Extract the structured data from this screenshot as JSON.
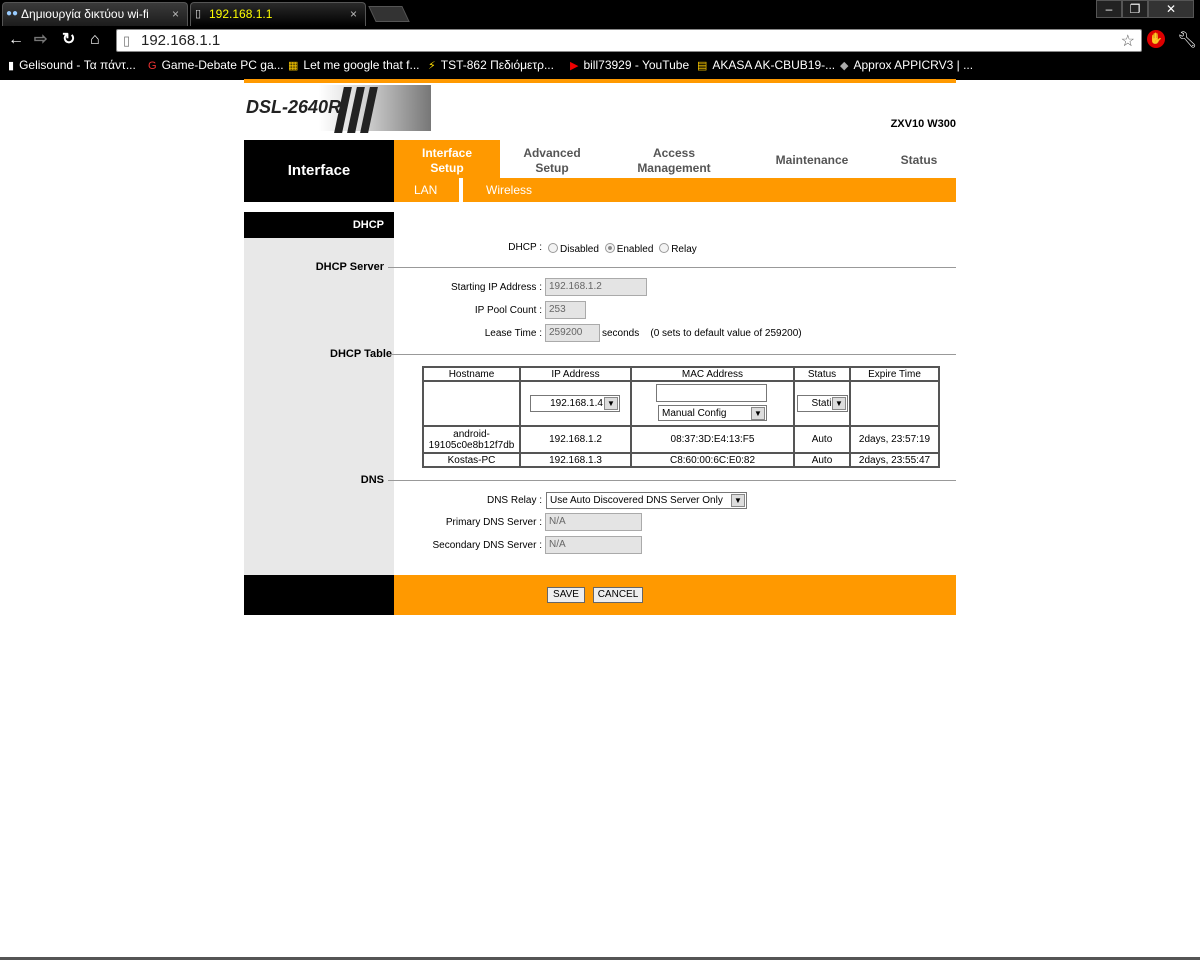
{
  "browser": {
    "tabs": [
      {
        "title": "Δημιουργία δικτύου wi-fi",
        "close": "×"
      },
      {
        "title": "192.168.1.1",
        "close": "×"
      }
    ],
    "url": "192.168.1.1",
    "bookmarks": [
      "Gelisound - Τα πάντ...",
      "Game-Debate PC ga...",
      "Let me google that f...",
      "TST-862 Πεδιόμετρ...",
      "bill73929 - YouTube",
      "AKASA AK-CBUB19-...",
      "Approx APPICRV3 | ..."
    ]
  },
  "router": {
    "model": "DSL-2640R",
    "submodel": "ZXV10 W300",
    "left_title": "Interface",
    "menu": {
      "interface_setup": [
        "Interface",
        "Setup"
      ],
      "advanced_setup": [
        "Advanced",
        "Setup"
      ],
      "access_management": [
        "Access",
        "Management"
      ],
      "maintenance": "Maintenance",
      "status": "Status"
    },
    "submenu": {
      "lan": "LAN",
      "wireless": "Wireless"
    },
    "sections": {
      "dhcp": "DHCP",
      "dhcp_server": "DHCP Server",
      "dhcp_table": "DHCP Table",
      "dns": "DNS"
    },
    "dhcp": {
      "label": "DHCP :",
      "options": [
        "Disabled",
        "Enabled",
        "Relay"
      ],
      "selected": "Enabled"
    },
    "dhcp_server": {
      "start_ip_label": "Starting IP Address :",
      "start_ip": "192.168.1.2",
      "pool_label": "IP Pool Count :",
      "pool": "253",
      "lease_label": "Lease Time :",
      "lease": "259200",
      "lease_unit": "seconds",
      "lease_note": "(0 sets to default value of 259200)"
    },
    "table": {
      "headers": [
        "Hostname",
        "IP Address",
        "MAC Address",
        "Status",
        "Expire Time"
      ],
      "ip_select": "192.168.1.4",
      "mac_select": "Manual Config",
      "status_select": "Static",
      "rows": [
        {
          "host": [
            "android-",
            "19105c0e8b12f7db"
          ],
          "ip": "192.168.1.2",
          "mac": "08:37:3D:E4:13:F5",
          "status": "Auto",
          "expire": "2days, 23:57:19"
        },
        {
          "host": [
            "Kostas-PC"
          ],
          "ip": "192.168.1.3",
          "mac": "C8:60:00:6C:E0:82",
          "status": "Auto",
          "expire": "2days, 23:55:47"
        }
      ]
    },
    "dns": {
      "relay_label": "DNS Relay :",
      "relay": "Use Auto Discovered DNS Server Only",
      "primary_label": "Primary DNS Server :",
      "primary": "N/A",
      "secondary_label": "Secondary DNS Server :",
      "secondary": "N/A"
    },
    "buttons": {
      "save": "SAVE",
      "cancel": "CANCEL"
    }
  },
  "colors": {
    "accent": "#ff9900",
    "dark": "#000000",
    "panel": "#e8e8e8"
  }
}
